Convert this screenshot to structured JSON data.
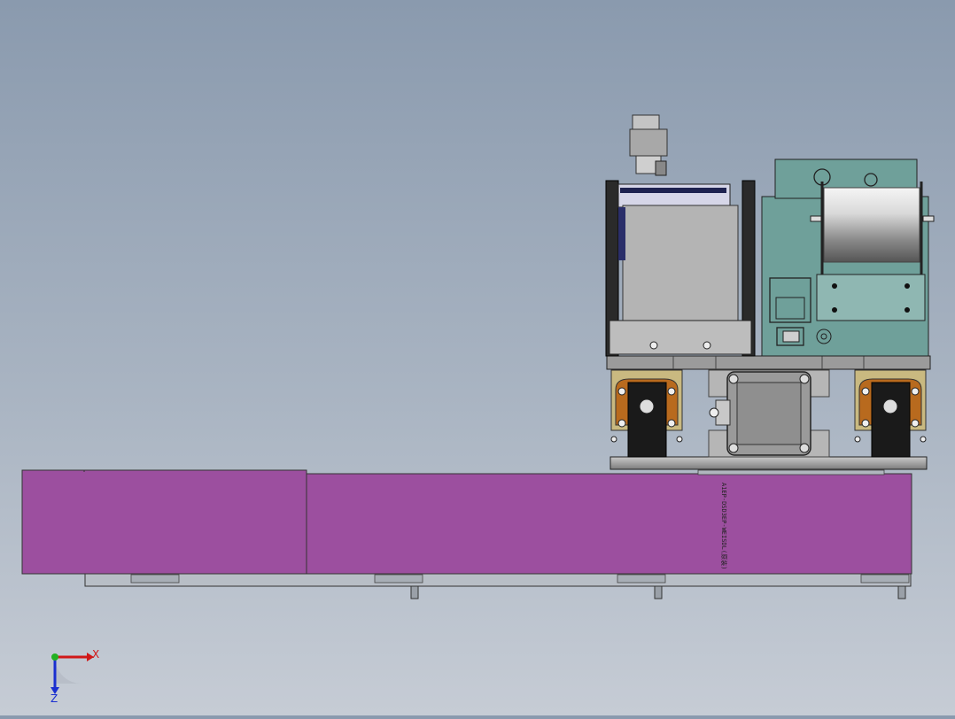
{
  "view": {
    "background_top": "#8a9aae",
    "background_bottom": "#c6ccd5"
  },
  "model": {
    "rail_color": "#9c4f9f",
    "housing_color": "#6fa09a",
    "motor_color": "#b9b9b9",
    "rail_label": "A1EP-DSD3EP-WEISDL(原装)"
  },
  "triad": {
    "x_label": "X",
    "z_label": "Z",
    "x_color": "#d01818",
    "z_color": "#1a2fd0",
    "y_color": "#22b022"
  }
}
